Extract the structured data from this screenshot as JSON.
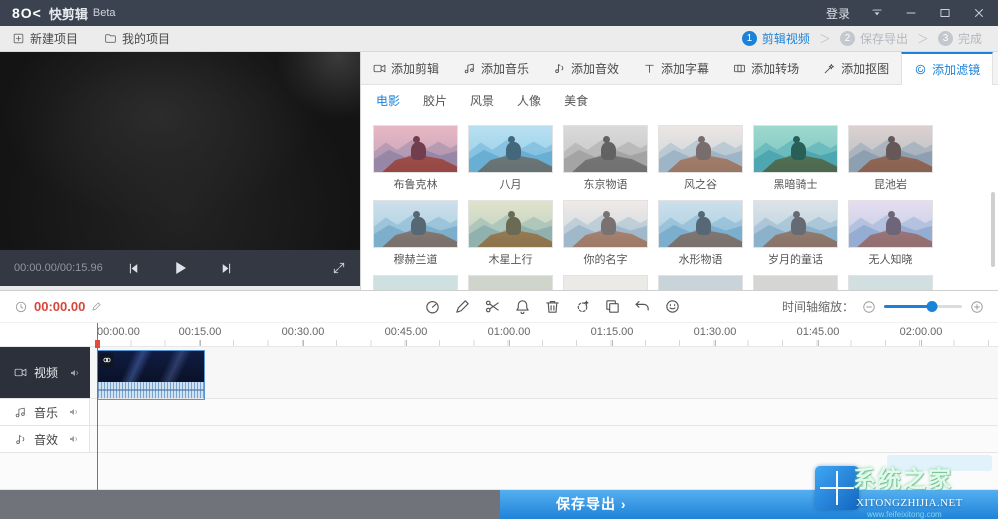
{
  "colors": {
    "accent": "#1b82d9",
    "time_red": "#d9453a",
    "export_blue": "#2a8fdf",
    "titlebar_bg": "#3b4350",
    "track_dark": "#2b303a"
  },
  "titlebar": {
    "logo": "8O<",
    "app_name": "快剪辑",
    "beta": "Beta",
    "login": "登录"
  },
  "project_bar": {
    "new_project": "新建项目",
    "my_projects": "我的项目",
    "separator": "＞",
    "steps": [
      {
        "num": "1",
        "label": "剪辑视频",
        "active": true
      },
      {
        "num": "2",
        "label": "保存导出",
        "active": false
      },
      {
        "num": "3",
        "label": "完成",
        "active": false
      }
    ]
  },
  "player": {
    "time": "00:00.00/00:15.96"
  },
  "panel": {
    "tabs": [
      {
        "id": "clip",
        "icon": "clip-icon",
        "label": "添加剪辑",
        "active": false
      },
      {
        "id": "music",
        "icon": "music-icon",
        "label": "添加音乐",
        "active": false
      },
      {
        "id": "sound",
        "icon": "sound-icon",
        "label": "添加音效",
        "active": false
      },
      {
        "id": "subtitle",
        "icon": "subtitle-icon",
        "label": "添加字幕",
        "active": false
      },
      {
        "id": "transition",
        "icon": "transition-icon",
        "label": "添加转场",
        "active": false
      },
      {
        "id": "cutout",
        "icon": "cutout-icon",
        "label": "添加抠图",
        "active": false
      },
      {
        "id": "filter",
        "icon": "filter-icon",
        "label": "添加滤镜",
        "active": true
      }
    ],
    "subtabs": [
      {
        "label": "电影",
        "active": true
      },
      {
        "label": "胶片",
        "active": false
      },
      {
        "label": "风景",
        "active": false
      },
      {
        "label": "人像",
        "active": false
      },
      {
        "label": "美食",
        "active": false
      }
    ],
    "filters": [
      {
        "name": "布鲁克林",
        "tint": "#e0607a",
        "grayscale": false
      },
      {
        "name": "八月",
        "tint": "#6fc2e6",
        "grayscale": false
      },
      {
        "name": "东京物语",
        "tint": "#b5b5b5",
        "grayscale": true
      },
      {
        "name": "风之谷",
        "tint": "#eccfc6",
        "grayscale": false
      },
      {
        "name": "黑暗骑士",
        "tint": "#2fae92",
        "grayscale": false
      },
      {
        "name": "昆池岩",
        "tint": "#c49e96",
        "grayscale": false
      },
      {
        "name": "穆赫兰道",
        "tint": "#9fc2d6",
        "grayscale": false
      },
      {
        "name": "木星上行",
        "tint": "#cdc78d",
        "grayscale": false
      },
      {
        "name": "你的名字",
        "tint": "#f4d8cf",
        "grayscale": false
      },
      {
        "name": "水形物语",
        "tint": "#9dc2da",
        "grayscale": false
      },
      {
        "name": "岁月的童话",
        "tint": "#c4c9d2",
        "grayscale": false
      },
      {
        "name": "无人知晓",
        "tint": "#d9bce2",
        "grayscale": false
      }
    ],
    "partial_row_tints": [
      "#cfe0e0",
      "#d0d5cc",
      "#eceae6",
      "#c8d4da",
      "#d5d5d3",
      "#d2dfe0"
    ]
  },
  "timeline": {
    "current_time": "00:00.00",
    "tools": [
      {
        "id": "speed",
        "icon": "speed-icon"
      },
      {
        "id": "pencil",
        "icon": "pencil-icon"
      },
      {
        "id": "scissors",
        "icon": "scissors-icon"
      },
      {
        "id": "bell",
        "icon": "bell-icon"
      },
      {
        "id": "trash",
        "icon": "trash-icon"
      },
      {
        "id": "magic",
        "icon": "magic-icon"
      },
      {
        "id": "copy",
        "icon": "copy-icon"
      },
      {
        "id": "undo",
        "icon": "undo-icon"
      },
      {
        "id": "smiley",
        "icon": "smiley-icon"
      }
    ],
    "zoom_label": "时间轴缩放：",
    "zoom_percent": 62,
    "ruler_labels": [
      "00:00.00",
      "00:15.00",
      "00:30.00",
      "00:45.00",
      "01:00.00",
      "01:15.00",
      "01:30.00",
      "01:45.00",
      "02:00.00"
    ],
    "tracks": [
      {
        "label": "视频"
      },
      {
        "label": "音乐"
      },
      {
        "label": "音效"
      }
    ]
  },
  "export": {
    "label": "保存导出 ›"
  },
  "watermark": {
    "site_name": "系统之家",
    "domain": "XITONGZHIJIA.NET",
    "sub": "www.feifeixitong.com"
  }
}
